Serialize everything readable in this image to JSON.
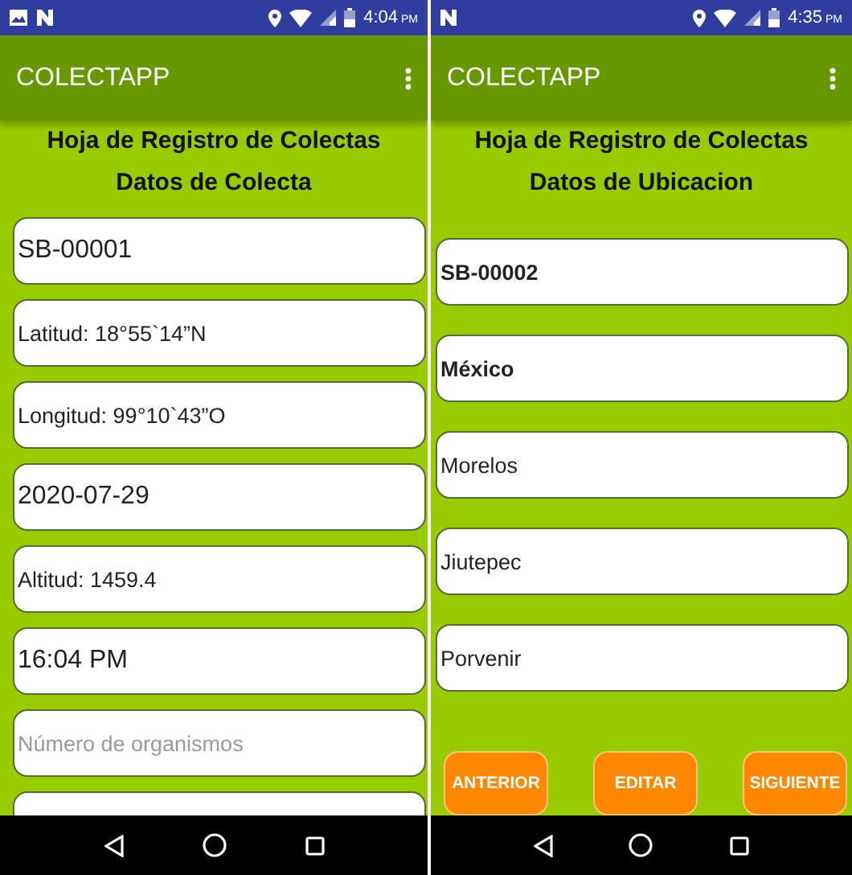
{
  "phones": [
    {
      "status_bar": {
        "notification_icons": [
          {
            "kind": "image"
          },
          {
            "kind": "n"
          }
        ],
        "time": "4:04",
        "period": "PM"
      },
      "app_bar": {
        "title": "COLECTAPP"
      },
      "headings": [
        "Hoja de Registro de Colectas",
        "Datos de Colecta"
      ],
      "fields": [
        {
          "kind": "entry",
          "value": "SB-00001",
          "emphasis": false
        },
        {
          "kind": "display",
          "value": "Latitud: 18°55`14”N",
          "emphasis": false
        },
        {
          "kind": "display",
          "value": "Longitud: 99°10`43”O",
          "emphasis": false
        },
        {
          "kind": "entry",
          "value": "2020-07-29",
          "emphasis": false
        },
        {
          "kind": "display",
          "value": "Altitud: 1459.4",
          "emphasis": false
        },
        {
          "kind": "entry",
          "value": "16:04 PM",
          "emphasis": false
        },
        {
          "kind": "display",
          "placeholder": "Número de organismos",
          "emphasis": false
        },
        {
          "kind": "partial"
        }
      ]
    },
    {
      "status_bar": {
        "notification_icons": [
          {
            "kind": "n"
          }
        ],
        "time": "4:35",
        "period": "PM"
      },
      "app_bar": {
        "title": "COLECTAPP"
      },
      "headings": [
        "Hoja de Registro de Colectas",
        "Datos de Ubicacion"
      ],
      "fields": [
        {
          "kind": "display",
          "value": "SB-00002",
          "emphasis": true
        },
        {
          "kind": "display",
          "value": "México",
          "emphasis": true
        },
        {
          "kind": "display",
          "value": "Morelos",
          "emphasis": false
        },
        {
          "kind": "display",
          "value": "Jiutepec",
          "emphasis": false
        },
        {
          "kind": "display",
          "value": "Porvenir",
          "emphasis": false
        }
      ],
      "buttons": [
        "ANTERIOR",
        "EDITAR",
        "SIGUIENTE"
      ]
    }
  ]
}
